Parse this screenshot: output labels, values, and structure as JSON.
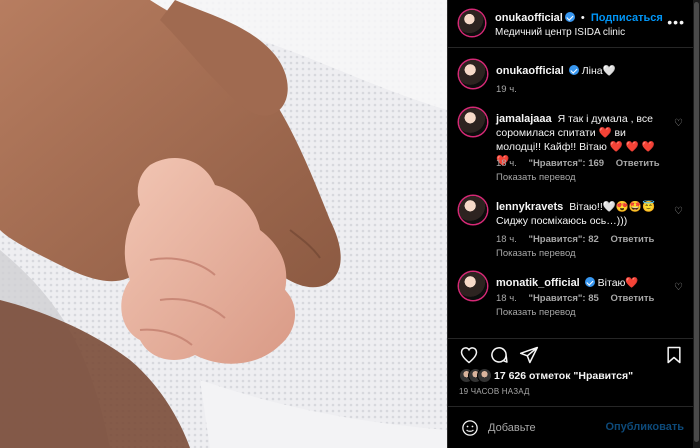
{
  "photo": {
    "alt_icon": "photo"
  },
  "header": {
    "username": "onukaofficial",
    "separator": "•",
    "follow_label": "Подписаться",
    "location": "Медичний центр ISIDA clinic",
    "more_icon": "more-horizontal-icon"
  },
  "caption": {
    "username": "onukaofficial",
    "text": "Ліна",
    "emoji": "🤍",
    "time": "19 ч."
  },
  "comments": [
    {
      "username": "jamalajaaa",
      "text": "Я так і думала , все соромилася спитати ❤️ ви молодці!! Кайф!! Вітаю ❤️ ❤️ ❤️ ❤️",
      "time": "18 ч.",
      "likes": "\"Нравится\": 169",
      "reply": "Ответить",
      "translate": "Показать перевод"
    },
    {
      "username": "lennykravets",
      "text": "Вітаю!!🤍😍🤩😇 Сиджу посміхаюсь ось…)))",
      "time": "18 ч.",
      "likes": "\"Нравится\": 82",
      "reply": "Ответить",
      "translate": "Показать перевод"
    },
    {
      "username": "monatik_official",
      "text": "Вітаю❤️",
      "time": "18 ч.",
      "likes": "\"Нравится\": 85",
      "reply": "Ответить",
      "translate": "Показать перевод"
    }
  ],
  "likes": {
    "text": "17 626 отметок \"Нравится\""
  },
  "time_ago": "19 ЧАСОВ НАЗАД",
  "add_comment": {
    "placeholder": "Добавьте",
    "publish_label": "Опубликовать"
  },
  "colors": {
    "accent": "#0095f6",
    "heart": "#ff3040",
    "background": "#000000",
    "muted_text": "#a8a8a8"
  }
}
